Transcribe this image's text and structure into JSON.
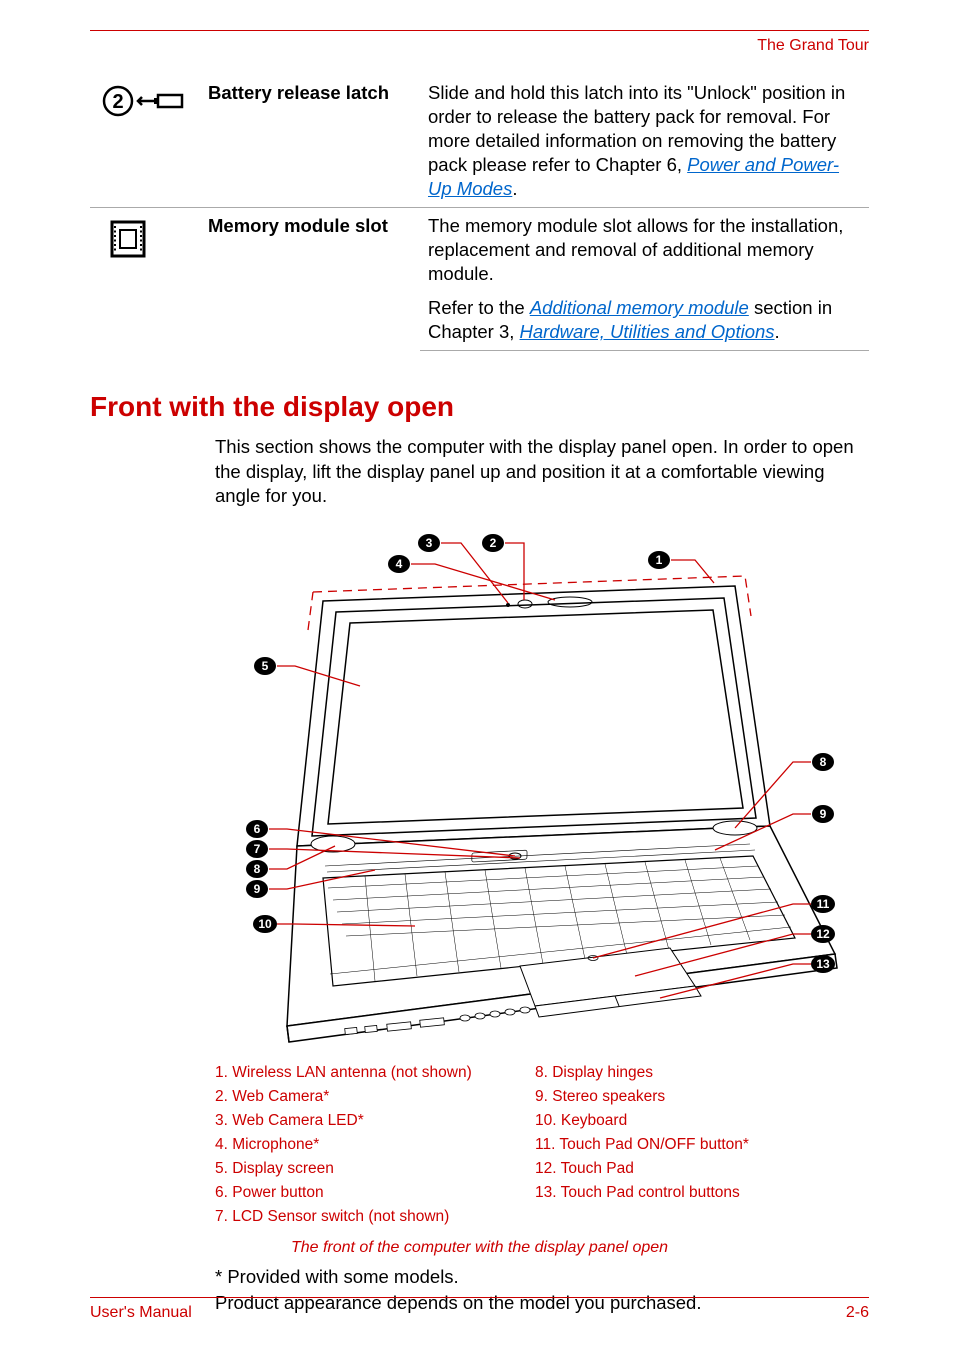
{
  "header": {
    "section_name": "The Grand Tour"
  },
  "rows": [
    {
      "term": "Battery release latch",
      "desc_pre": "Slide and hold this latch into its \"Unlock\" position in order to release the battery pack for removal. For more detailed information on removing the battery pack please refer to Chapter 6, ",
      "link1": "Power and Power-Up Modes",
      "desc_post": "."
    },
    {
      "term": "Memory module slot",
      "desc_a": "The memory module slot allows for the installation, replacement and removal of additional memory module.",
      "desc_b_pre": "Refer to the ",
      "desc_b_link1": "Additional memory module",
      "desc_b_mid": " section in Chapter 3, ",
      "desc_b_link2": "Hardware, Utilities and Options",
      "desc_b_post": "."
    }
  ],
  "heading": "Front with the display open",
  "intro": "This section shows the computer with the display panel open. In order to open the display, lift the display panel up and position it at a comfortable viewing angle for you.",
  "callouts_left": [
    "1. Wireless LAN antenna (not shown)",
    "2. Web Camera*",
    "3. Web Camera LED*",
    "4. Microphone*",
    "5. Display screen",
    "6. Power button",
    "7. LCD Sensor switch (not shown)"
  ],
  "callouts_right": [
    "8. Display hinges",
    "9. Stereo speakers",
    "10. Keyboard",
    "11. Touch Pad ON/OFF button*",
    "12. Touch Pad",
    "13. Touch Pad control buttons"
  ],
  "caption": "The front of the computer with the display panel open",
  "note1": "* Provided with some models.",
  "note2": "Product appearance depends on the model you purchased.",
  "labels": {
    "n1": "1",
    "n2": "2",
    "n3": "3",
    "n4": "4",
    "n5": "5",
    "n6": "6",
    "n7": "7",
    "n8": "8",
    "n9": "9",
    "n10": "10",
    "n11": "11",
    "n12": "12",
    "n13": "13"
  },
  "footer": {
    "left": "User's Manual",
    "right": "2-6"
  }
}
